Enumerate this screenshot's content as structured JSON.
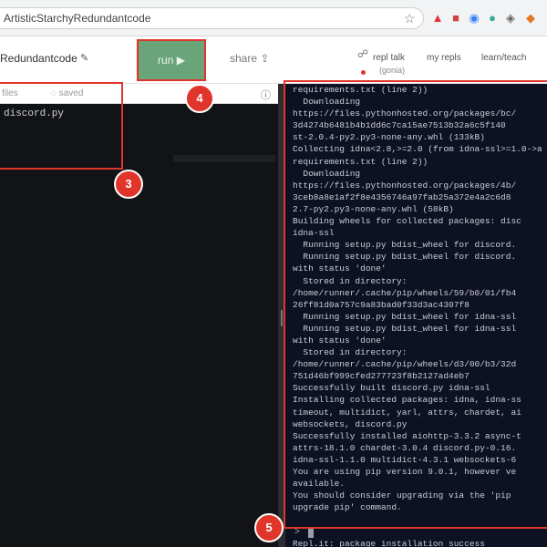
{
  "browser": {
    "url": "ArtisticStarchyRedundantcode",
    "icons": [
      "star-icon",
      "extension-icon-1",
      "extension-icon-2",
      "extension-icon-3",
      "extension-icon-4",
      "extension-icon-5",
      "extension-icon-6"
    ]
  },
  "header": {
    "repl_name": "Redundantcode",
    "run_label": "run ▶",
    "share_label": "share ⇪",
    "nav": {
      "talk": "repl talk",
      "talk_sub": "(gonia)",
      "my_repls": "my repls",
      "learn": "learn/teach"
    }
  },
  "files": {
    "tabs": [
      "files",
      "saved"
    ],
    "items": [
      "discord.py"
    ]
  },
  "console": {
    "lines": [
      "requirements.txt (line 2))",
      "  Downloading",
      "https://files.pythonhosted.org/packages/bc/",
      "3d4274b6481b4b1dd6c7ca15ae7513b32a6c5f140",
      "st-2.0.4-py2.py3-none-any.whl (133kB)",
      "Collecting idna<2.8,>=2.0 (from idna-ssl>=1.0->a",
      "requirements.txt (line 2))",
      "  Downloading",
      "https://files.pythonhosted.org/packages/4b/",
      "3ceb8a8e1af2f8e4356746a97fab25a372e4a2c6d8",
      "2.7-py2.py3-none-any.whl (58kB)",
      "Building wheels for collected packages: disc",
      "idna-ssl",
      "  Running setup.py bdist_wheel for discord.",
      "  Running setup.py bdist_wheel for discord.",
      "with status 'done'",
      "  Stored in directory:",
      "/home/runner/.cache/pip/wheels/59/b0/01/fb4",
      "26ff81d0a757c9a83bad0f33d3ac4307f8",
      "  Running setup.py bdist_wheel for idna-ssl",
      "  Running setup.py bdist_wheel for idna-ssl",
      "with status 'done'",
      "  Stored in directory:",
      "/home/runner/.cache/pip/wheels/d3/00/b3/32d",
      "751d46bf999cfed277723f8b2127ad4eb7",
      "Successfully built discord.py idna-ssl",
      "Installing collected packages: idna, idna-ss",
      "timeout, multidict, yarl, attrs, chardet, ai",
      "websockets, discord.py",
      "Successfully installed aiohttp-3.3.2 async-t",
      "attrs-18.1.0 chardet-3.0.4 discord.py-0.16.",
      "idna-ssl-1.1.0 multidict-4.3.1 websockets-6",
      "You are using pip version 9.0.1, however ve",
      "available.",
      "You should consider upgrading via the 'pip",
      "upgrade pip' command.",
      "",
      "",
      "Repl.it: package installation success"
    ],
    "prompt": ">"
  },
  "annotations": {
    "badges": [
      "3",
      "4",
      "5"
    ],
    "color": "#e0352b"
  },
  "colors": {
    "run_button": "#6aa57a",
    "console_bg": "#0e1122",
    "editor_bg": "#121316",
    "highlight": "#e0352b"
  }
}
